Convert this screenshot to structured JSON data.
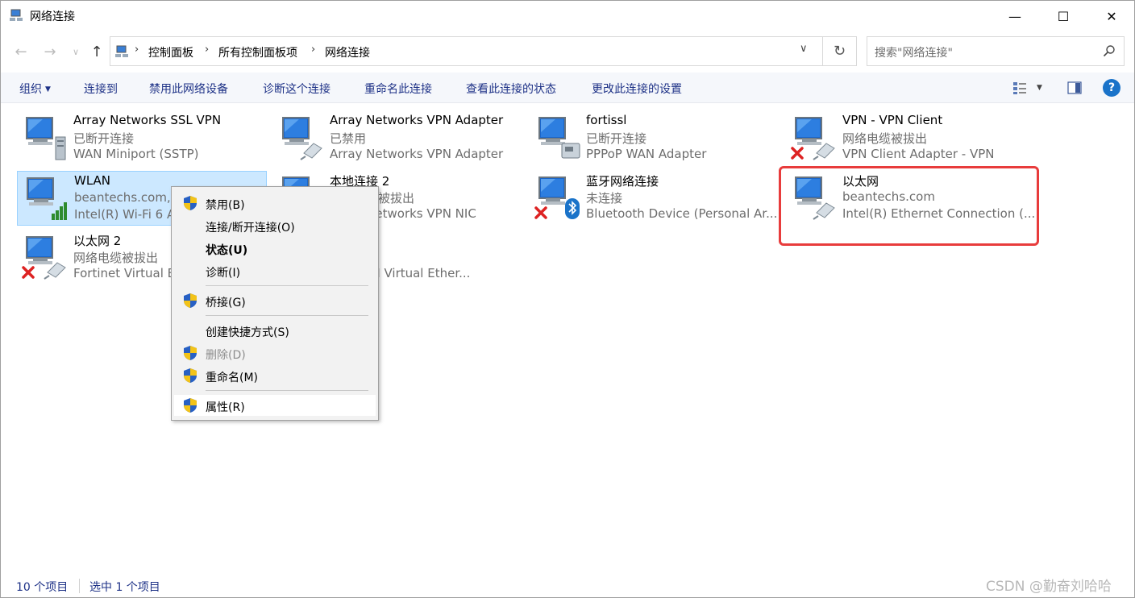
{
  "window": {
    "title": "网络连接",
    "minimize_glyph": "—",
    "maximize_glyph": "☐",
    "close_glyph": "✕"
  },
  "address": {
    "crumbs": [
      "控制面板",
      "所有控制面板项",
      "网络连接"
    ],
    "search_placeholder": "搜索\"网络连接\""
  },
  "commands": {
    "organize": "组织",
    "connect_to": "连接到",
    "disable": "禁用此网络设备",
    "diagnose": "诊断这个连接",
    "rename": "重命名此连接",
    "view_status": "查看此连接的状态",
    "change_settings": "更改此连接的设置"
  },
  "connections": [
    {
      "name": "Array Networks SSL VPN",
      "status": "已断开连接",
      "device": "WAN Miniport (SSTP)",
      "icon": "network-server-icon"
    },
    {
      "name": "Array Networks VPN Adapter",
      "status": "已禁用",
      "device": "Array Networks VPN Adapter",
      "icon": "network-cable-icon"
    },
    {
      "name": "fortissl",
      "status": "已断开连接",
      "device": "PPPoP WAN Adapter",
      "icon": "network-modem-icon"
    },
    {
      "name": "VPN - VPN Client",
      "status": "网络电缆被拔出",
      "device": "VPN Client Adapter - VPN",
      "icon": "network-cable-icon",
      "error": true
    },
    {
      "name": "WLAN",
      "status": "beantechs.com, 3",
      "device": "Intel(R) Wi-Fi 6 AX",
      "icon": "wifi-signal-icon",
      "selected": true
    },
    {
      "name": "本地连接 2",
      "status": "网络电缆被拔出",
      "device": "Array Networks VPN NIC",
      "icon": "network-cable-icon"
    },
    {
      "name": "蓝牙网络连接",
      "status": "未连接",
      "device": "Bluetooth Device (Personal Ar...",
      "icon": "bluetooth-icon",
      "error": true
    },
    {
      "name": "以太网",
      "status": "beantechs.com",
      "device": "Intel(R) Ethernet Connection (...",
      "icon": "network-cable-icon",
      "highlighted": true
    },
    {
      "name": "以太网 2",
      "status": "网络电缆被拔出",
      "device": "Fortinet Virtual Ethernet",
      "icon": "network-cable-icon",
      "error": true
    },
    {
      "name": "",
      "status": "",
      "device": "SSL VPN Virtual Ether...",
      "icon": "network-cable-icon"
    }
  ],
  "context_menu": {
    "disable": "禁用(B)",
    "connect": "连接/断开连接(O)",
    "status": "状态(U)",
    "diagnose": "诊断(I)",
    "bridge": "桥接(G)",
    "shortcut": "创建快捷方式(S)",
    "delete": "删除(D)",
    "rename": "重命名(M)",
    "properties": "属性(R)"
  },
  "statusbar": {
    "count": "10 个项目",
    "selected": "选中 1 个项目"
  },
  "watermark": "CSDN @勤奋刘哈哈",
  "colors": {
    "accent_blue": "#1e3287",
    "selection": "#cce8ff",
    "highlight_red": "#e83c3c"
  }
}
